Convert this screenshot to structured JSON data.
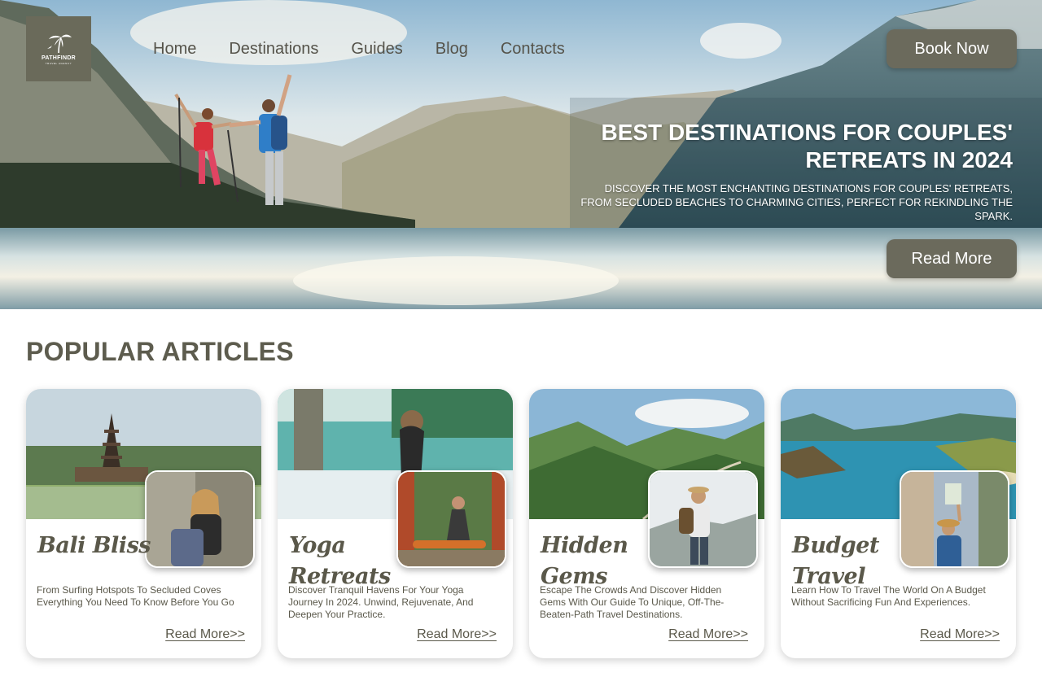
{
  "brand": {
    "name": "PATHFINDR",
    "tagline": "TRAVEL AGENCY"
  },
  "nav": [
    "Home",
    "Destinations",
    "Guides",
    "Blog",
    "Contacts"
  ],
  "hero": {
    "book_label": "Book Now",
    "title": "BEST DESTINATIONS FOR COUPLES' RETREATS IN 2024",
    "subtitle": "DISCOVER THE MOST ENCHANTING DESTINATIONS FOR COUPLES' RETREATS, FROM SECLUDED BEACHES TO CHARMING CITIES, PERFECT FOR REKINDLING THE SPARK.",
    "read_label": "Read More"
  },
  "section": {
    "title": "POPULAR ARTICLES"
  },
  "articles": [
    {
      "title": "Bali Bliss",
      "description": "From Surfing Hotspots To Secluded Coves Everything You Need To Know Before You Go",
      "link": "Read More>>"
    },
    {
      "title": "Yoga Retreats",
      "description": "Discover Tranquil Havens For Your Yoga Journey In 2024. Unwind, Rejuvenate, And Deepen Your Practice.",
      "link": "Read More>>"
    },
    {
      "title": "Hidden Gems",
      "description": "Escape The Crowds And Discover Hidden Gems With Our Guide To Unique, Off-The-Beaten-Path Travel Destinations.",
      "link": "Read More>>"
    },
    {
      "title": "Budget Travel",
      "description": "Learn How To Travel The World On A Budget Without Sacrificing Fun And Experiences.",
      "link": "Read More>>"
    }
  ],
  "colors": {
    "accent": "#6b6a5c",
    "text": "#55534a"
  }
}
